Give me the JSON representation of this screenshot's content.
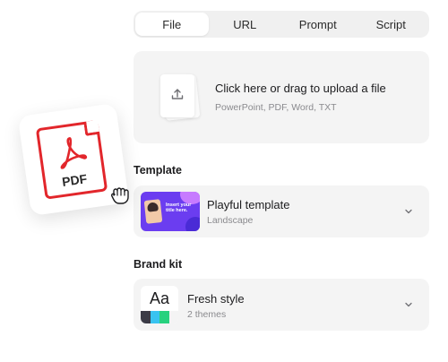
{
  "tabs": [
    {
      "label": "File",
      "active": true
    },
    {
      "label": "URL",
      "active": false
    },
    {
      "label": "Prompt",
      "active": false
    },
    {
      "label": "Script",
      "active": false
    }
  ],
  "upload": {
    "title": "Click here or drag to upload a file",
    "subtitle": "PowerPoint, PDF, Word, TXT"
  },
  "template": {
    "section_label": "Template",
    "name": "Playful template",
    "sub": "Landscape",
    "thumb_text": "Insert your title here."
  },
  "brand": {
    "section_label": "Brand kit",
    "name": "Fresh style",
    "sub": "2 themes",
    "thumb_text": "Aa",
    "swatches": [
      "#3b3b46",
      "#39c3f0",
      "#27d17e",
      "#f4f4f4"
    ]
  },
  "pdf_card": {
    "label": "PDF",
    "accent": "#e2262b"
  },
  "icons": {
    "upload": "upload-icon",
    "chevron": "chevron-down-icon",
    "cursor": "grab-hand-icon",
    "pdf": "pdf-file-icon"
  }
}
